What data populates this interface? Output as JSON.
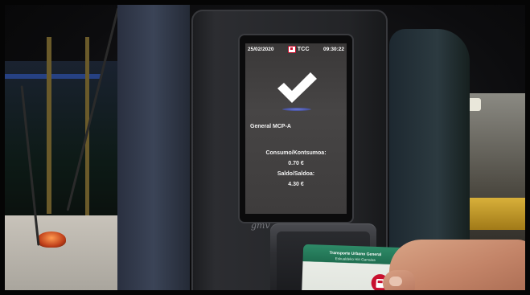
{
  "validator": {
    "brand": "gmv",
    "status_bar": {
      "date": "25/02/2020",
      "logo_text": "TCC",
      "time": "09:30:22"
    },
    "result_icon": "checkmark-icon",
    "profile": "General MCP-A",
    "consumption_label": "Consumo/Kontsumoa:",
    "consumption_value": "0.70 €",
    "balance_label": "Saldo/Saldoa:",
    "balance_value": "4.30 €"
  },
  "card": {
    "title": "Transporte Urbano General",
    "subtitle": "Eskualdeko Hiri Garraioa",
    "icon": "bus-icon"
  },
  "colors": {
    "screen_bg": "#424040",
    "card_green": "#2e8a67",
    "brand_red": "#c8102e"
  }
}
